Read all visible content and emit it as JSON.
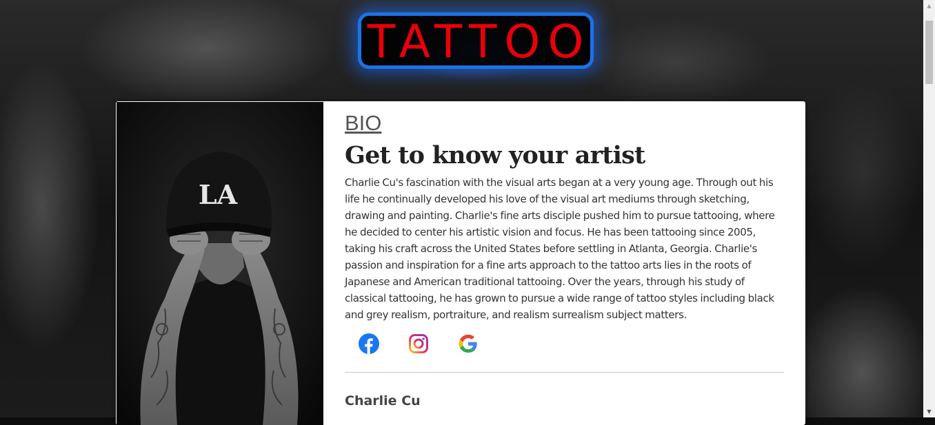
{
  "header": {
    "logo_text": "TATTOO",
    "logo_border_color": "#1a73e8",
    "logo_text_color": "#e8000b"
  },
  "bio": {
    "section_link": "BIO",
    "heading": "Get to know your artist",
    "text": "Charlie Cu's fascination with the visual arts began at a very young age. Through out his life he continually developed his love of the visual art mediums through sketching, drawing and painting. Charlie's fine arts disciple pushed him to pursue tattooing, where he decided to center his artistic vision and focus. He has been tattooing since 2005, taking his craft across the United States before settling in Atlanta, Georgia. Charlie's passion and inspiration for a fine arts approach to the tattoo arts lies in the roots of Japanese and American traditional tattooing. Over the years, through his study of classical tattooing, he has grown to pursue a wide range of tattoo styles including black and grey realism, portraiture, and realism surrealism subject matters.",
    "social_icons": [
      "facebook-icon",
      "instagram-icon",
      "google-icon"
    ],
    "artist_name": "Charlie Cu",
    "cap_logo": "LA"
  }
}
